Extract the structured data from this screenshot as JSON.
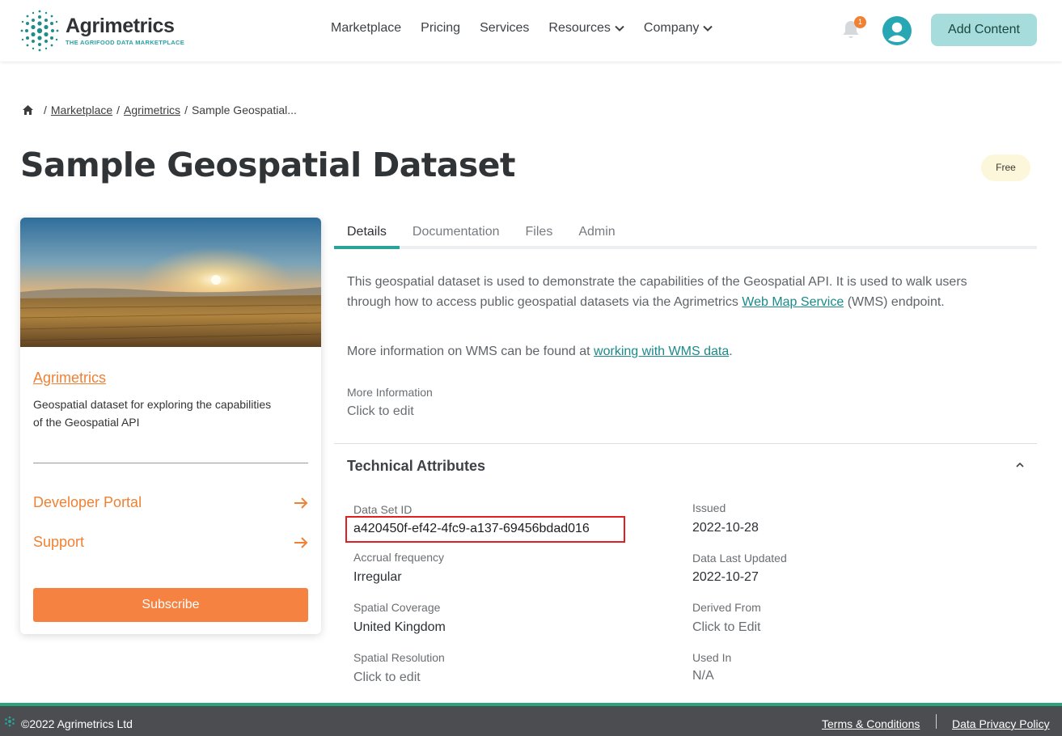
{
  "header": {
    "logo_name": "Agrimetrics",
    "logo_tagline": "THE AGRIFOOD DATA MARKETPLACE",
    "nav": [
      "Marketplace",
      "Pricing",
      "Services",
      "Resources",
      "Company"
    ],
    "notification_count": "1",
    "add_content_label": "Add Content"
  },
  "breadcrumb": {
    "items": [
      "Marketplace",
      "Agrimetrics",
      "Sample Geospatial..."
    ]
  },
  "page": {
    "title": "Sample Geospatial Dataset",
    "price_badge": "Free"
  },
  "card": {
    "provider": "Agrimetrics",
    "description": "Geospatial dataset for exploring the capabilities of the Geospatial API",
    "developer_portal": "Developer Portal",
    "support": "Support",
    "subscribe": "Subscribe"
  },
  "tabs": [
    "Details",
    "Documentation",
    "Files",
    "Admin"
  ],
  "details": {
    "desc_part1": "This geospatial dataset is used to demonstrate the capabilities of the Geospatial API. It is used to walk users through how to access public geospatial datasets via the Agrimetrics ",
    "desc_link": "Web Map Service",
    "desc_part2": " (WMS) endpoint.",
    "more_prefix": "More information on WMS can be found at ",
    "more_link": "working with WMS data",
    "more_suffix": ".",
    "more_info_label": "More Information",
    "more_info_value": "Click to edit"
  },
  "technical": {
    "title": "Technical Attributes",
    "left": [
      {
        "label": "Data Set ID",
        "value": "a420450f-ef42-4fc9-a137-69456bdad016"
      },
      {
        "label": "Accrual frequency",
        "value": "Irregular"
      },
      {
        "label": "Spatial Coverage",
        "value": "United Kingdom"
      },
      {
        "label": "Spatial Resolution",
        "value": "Click to edit"
      }
    ],
    "right": [
      {
        "label": "Issued",
        "value": "2022-10-28"
      },
      {
        "label": "Data Last Updated",
        "value": "2022-10-27"
      },
      {
        "label": "Derived From",
        "value": "Click to Edit"
      },
      {
        "label": "Used In",
        "value": "N/A"
      }
    ]
  },
  "footer": {
    "copyright": "©2022 Agrimetrics Ltd",
    "terms": "Terms & Conditions",
    "privacy": "Data Privacy Policy"
  },
  "colors": {
    "accent_orange": "#f08133",
    "teal": "#2aa39a",
    "add_content_bg": "#a6dcdb",
    "footer_bg": "#4c4d50",
    "highlight_red": "#e02020"
  }
}
